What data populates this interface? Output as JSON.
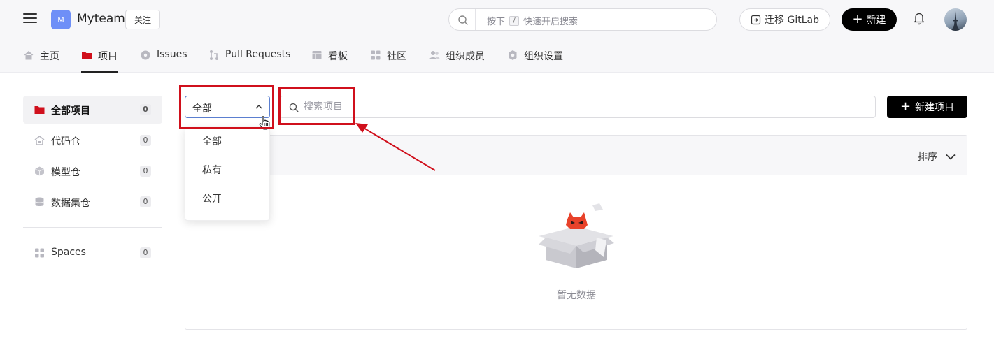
{
  "header": {
    "team_avatar_letter": "M",
    "team_name": "Myteam",
    "follow_label": "关注",
    "search_hint_prefix": "按下",
    "search_hint_key": "/",
    "search_hint_suffix": "快速开启搜索",
    "gitlab_label": "迁移 GitLab",
    "new_label": "新建"
  },
  "nav": {
    "tabs": [
      {
        "label": "主页",
        "icon": "home-icon"
      },
      {
        "label": "项目",
        "icon": "folder-icon",
        "active": true
      },
      {
        "label": "Issues",
        "icon": "issues-icon"
      },
      {
        "label": "Pull Requests",
        "icon": "pull-request-icon"
      },
      {
        "label": "看板",
        "icon": "board-icon"
      },
      {
        "label": "社区",
        "icon": "community-icon"
      },
      {
        "label": "组织成员",
        "icon": "members-icon"
      },
      {
        "label": "组织设置",
        "icon": "settings-icon"
      }
    ]
  },
  "sidebar": {
    "items": [
      {
        "label": "全部项目",
        "count": "0",
        "icon": "folder-icon",
        "active": true
      },
      {
        "label": "代码仓",
        "count": "0",
        "icon": "code-repo-icon"
      },
      {
        "label": "模型仓",
        "count": "0",
        "icon": "model-cube-icon"
      },
      {
        "label": "数据集仓",
        "count": "0",
        "icon": "database-icon"
      },
      {
        "label": "Spaces",
        "count": "0",
        "icon": "spaces-grid-icon"
      }
    ]
  },
  "filter": {
    "selected": "全部",
    "options": [
      "全部",
      "私有",
      "公开"
    ]
  },
  "project_search": {
    "placeholder": "搜索项目"
  },
  "new_project_label": "新建项目",
  "list": {
    "sort_label": "排序",
    "empty_text": "暂无数据"
  },
  "colors": {
    "accent_red": "#d0101c",
    "primary_black": "#000000",
    "select_border": "#5b7fd0"
  }
}
